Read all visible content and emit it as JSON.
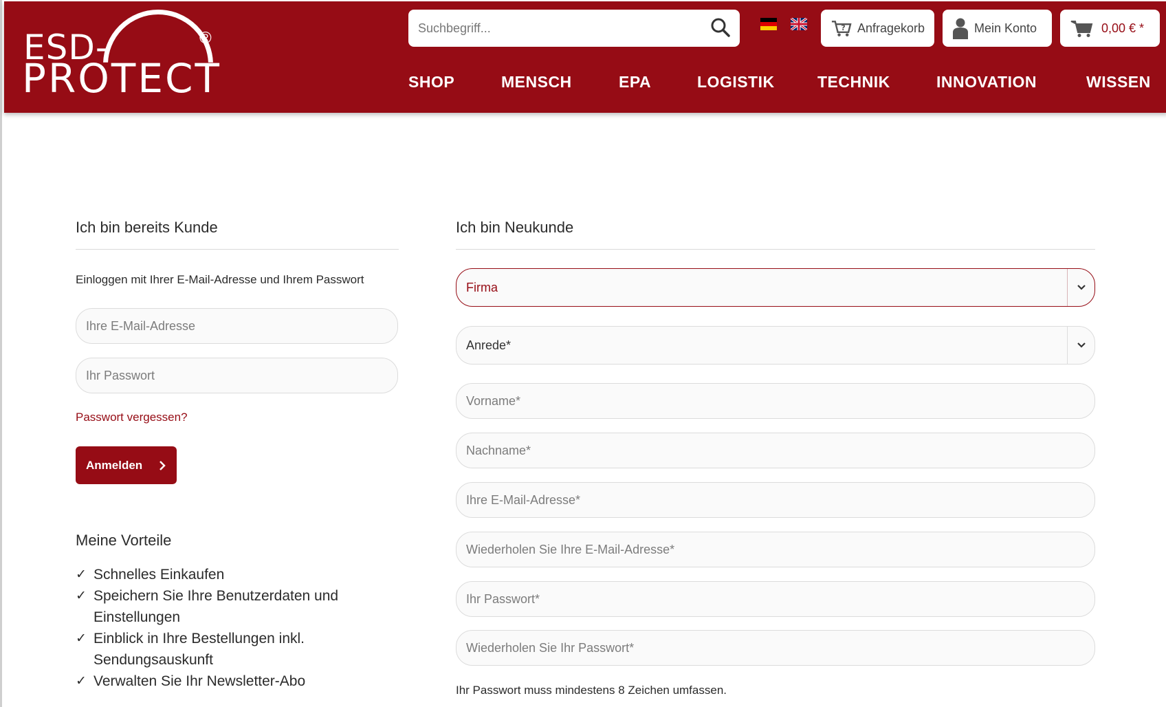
{
  "header": {
    "logo": {
      "line1": "ESD-",
      "line2": "PROTECT",
      "reg": "®"
    },
    "search": {
      "placeholder": "Suchbegriff..."
    },
    "languages": [
      "de",
      "en"
    ],
    "anfragekorb_label": "Anfragekorb",
    "konto_label": "Mein Konto",
    "cart_price": "0,00 € *",
    "brand_color": "#960c15"
  },
  "nav": {
    "items": [
      "SHOP",
      "MENSCH",
      "EPA",
      "LOGISTIK",
      "TECHNIK",
      "INNOVATION",
      "WISSEN"
    ]
  },
  "login": {
    "title": "Ich bin bereits Kunde",
    "intro": "Einloggen mit Ihrer E-Mail-Adresse und Ihrem Passwort",
    "email_placeholder": "Ihre E-Mail-Adresse",
    "password_placeholder": "Ihr Passwort",
    "forgot_link": "Passwort vergessen?",
    "submit_label": "Anmelden"
  },
  "benefits": {
    "title": "Meine Vorteile",
    "items": [
      "Schnelles Einkaufen",
      "Speichern Sie Ihre Benutzerdaten und Einstellungen",
      "Einblick in Ihre Bestellungen inkl. Sendungsauskunft",
      "Verwalten Sie Ihr Newsletter-Abo"
    ]
  },
  "register": {
    "title": "Ich bin Neukunde",
    "customer_type_value": "Firma",
    "salutation_value": "Anrede*",
    "firstname_placeholder": "Vorname*",
    "lastname_placeholder": "Nachname*",
    "email_placeholder": "Ihre E-Mail-Adresse*",
    "email_repeat_placeholder": "Wiederholen Sie Ihre E-Mail-Adresse*",
    "password_placeholder": "Ihr Passwort*",
    "password_repeat_placeholder": "Wiederholen Sie Ihr Passwort*",
    "password_hint": "Ihr Passwort muss mindestens 8 Zeichen umfassen."
  }
}
